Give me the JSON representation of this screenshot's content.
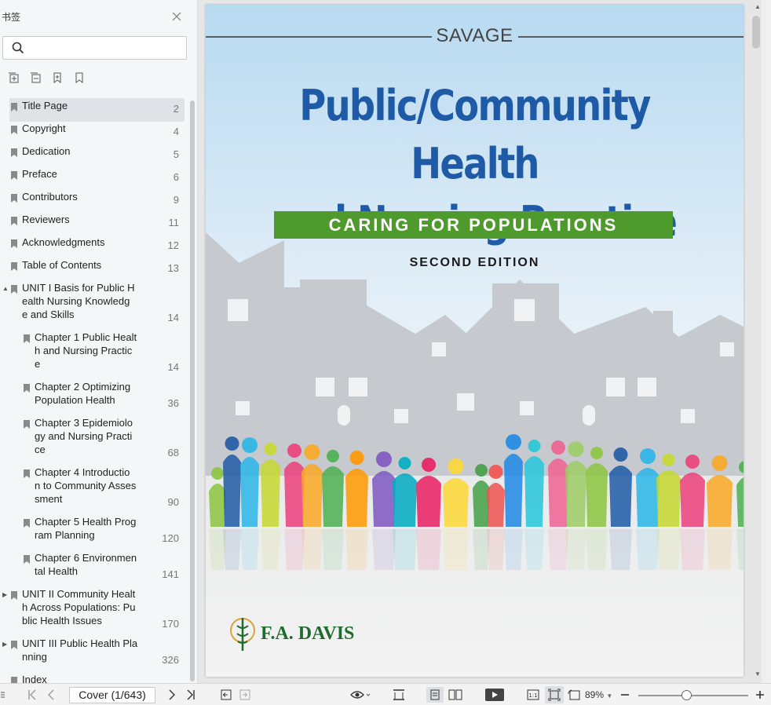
{
  "sidebar": {
    "title": "书签",
    "search_placeholder": "",
    "items": [
      {
        "label": "Title Page",
        "page": "2",
        "level": 0,
        "selected": true,
        "expander": ""
      },
      {
        "label": "Copyright",
        "page": "4",
        "level": 0,
        "expander": ""
      },
      {
        "label": "Dedication",
        "page": "5",
        "level": 0,
        "expander": ""
      },
      {
        "label": "Preface",
        "page": "6",
        "level": 0,
        "expander": ""
      },
      {
        "label": "Contributors",
        "page": "9",
        "level": 0,
        "expander": ""
      },
      {
        "label": "Reviewers",
        "page": "11",
        "level": 0,
        "expander": ""
      },
      {
        "label": "Acknowledgments",
        "page": "12",
        "level": 0,
        "expander": ""
      },
      {
        "label": "Table of Contents",
        "page": "13",
        "level": 0,
        "expander": ""
      },
      {
        "label": "UNIT I Basis for Public H\nealth Nursing Knowledg\ne and Skills",
        "page": "14",
        "level": 0,
        "expander": "▲"
      },
      {
        "label": "Chapter 1 Public Healt\nh and Nursing Practic\ne",
        "page": "14",
        "level": 1,
        "expander": ""
      },
      {
        "label": "Chapter 2 Optimizing\nPopulation Health",
        "page": "36",
        "level": 1,
        "expander": ""
      },
      {
        "label": "Chapter 3 Epidemiolo\ngy and Nursing Practi\nce",
        "page": "68",
        "level": 1,
        "expander": ""
      },
      {
        "label": "Chapter 4  Introductio\nn to Community Asses\nsment",
        "page": "90",
        "level": 1,
        "expander": ""
      },
      {
        "label": "Chapter 5 Health Prog\nram Planning",
        "page": "120",
        "level": 1,
        "expander": ""
      },
      {
        "label": "Chapter 6 Environmen\ntal Health",
        "page": "141",
        "level": 1,
        "expander": ""
      },
      {
        "label": "UNIT II Community Healt\nh Across Populations: Pu\nblic Health Issues",
        "page": "170",
        "level": 0,
        "expander": "▶"
      },
      {
        "label": "UNIT III Public Health Pla\nnning",
        "page": "326",
        "level": 0,
        "expander": "▶"
      },
      {
        "label": "Index",
        "page": "",
        "level": 0,
        "expander": ""
      }
    ]
  },
  "cover": {
    "author": "SAVAGE",
    "title_line1": "Public/Community Health",
    "title_line2": "and Nursing Practice",
    "subtitle": "CARING FOR POPULATIONS",
    "edition": "SECOND EDITION",
    "publisher": "F.A. DAVIS",
    "colors": {
      "title": "#1f5aa6",
      "subtitle_bg": "#4e9a2c",
      "sky_top": "#b9dbf2",
      "houses": "#c4c7cb"
    }
  },
  "statusbar": {
    "page_field": "Cover (1/643)",
    "zoom": "89%"
  }
}
